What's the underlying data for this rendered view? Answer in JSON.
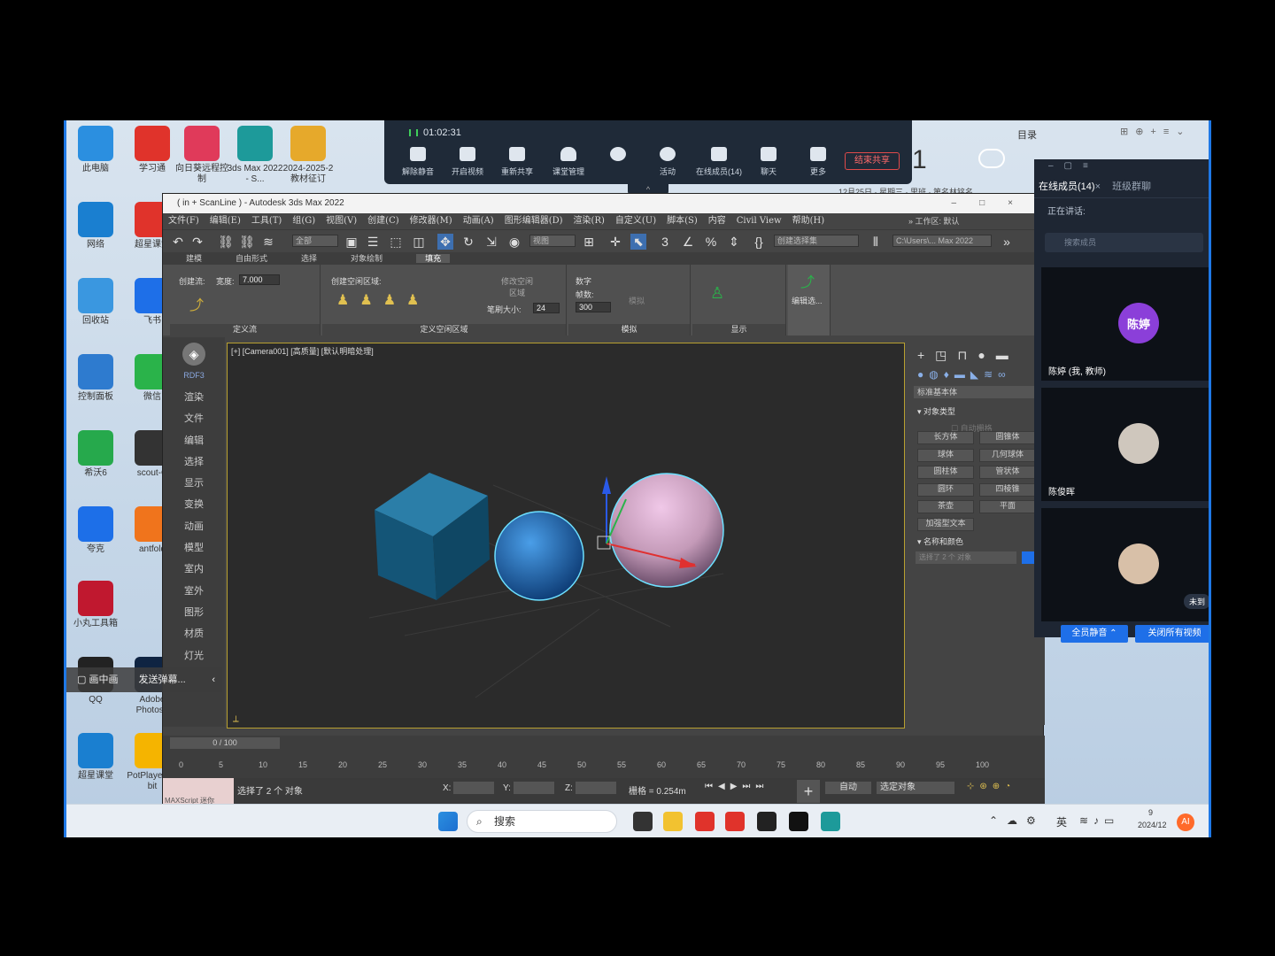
{
  "desktop_icons": [
    {
      "label": "此电脑",
      "color": "#2b8fe0"
    },
    {
      "label": "学习通",
      "color": "#e0332b"
    },
    {
      "label": "向日葵远程控制",
      "color": "#e03a5a"
    },
    {
      "label": "3ds Max 2022 - S...",
      "color": "#1d9a9a"
    },
    {
      "label": "2024-2025-2 教材征订",
      "color": "#e6a92b"
    },
    {
      "label": "网络",
      "color": "#1a7fd0"
    },
    {
      "label": "超星课堂",
      "color": "#e0332b"
    },
    {
      "label": "回收站",
      "color": "#3a97e0"
    },
    {
      "label": "飞书",
      "color": "#1e6fe8"
    },
    {
      "label": "控制面板",
      "color": "#2e7bcf"
    },
    {
      "label": "微信",
      "color": "#2ab34a"
    },
    {
      "label": "希沃6",
      "color": "#26a94c"
    },
    {
      "label": "scout-C",
      "color": "#333333"
    },
    {
      "label": "夸克",
      "color": "#1d6fe8"
    },
    {
      "label": "antfold",
      "color": "#f0741c"
    },
    {
      "label": "小丸工具箱",
      "color": "#c0182f"
    },
    {
      "label": "QQ",
      "color": "#222222"
    },
    {
      "label": "Adobe Photosh",
      "color": "#0f2442"
    },
    {
      "label": "超星课堂",
      "color": "#1a7fd0"
    },
    {
      "label": "PotPlayer 64 bit",
      "color": "#f5b400"
    }
  ],
  "meeting_bar": {
    "timer": "01:02:31",
    "buttons": [
      "解除静音",
      "开启视频",
      "重新共享",
      "课堂管理",
      "",
      "活动",
      "在线成员(14)",
      "聊天",
      "更多"
    ],
    "end_share": "结束共享",
    "handle": "^"
  },
  "right_pane": {
    "big_number": "1",
    "catalog": "目录",
    "date_hint": "12月25日 · 星期三 · 里班 · 第名林铭名"
  },
  "max_window": {
    "title": "( in + ScanLine ) - Autodesk 3ds Max 2022",
    "menus": [
      "文件(F)",
      "编辑(E)",
      "工具(T)",
      "组(G)",
      "视图(V)",
      "创建(C)",
      "修改器(M)",
      "动画(A)",
      "图形编辑器(D)",
      "渲染(R)",
      "自定义(U)",
      "脚本(S)",
      "内容",
      "Civil View",
      "帮助(H)"
    ],
    "workspace_label": "工作区:",
    "workspace_value": "默认",
    "toolbar_all": "全部",
    "toolbar_view": "视图",
    "toolbar_selset": "创建选择集",
    "toolbar_path": "C:\\Users\\... Max 2022",
    "ribbon_tabs": [
      "建模",
      "自由形式",
      "选择",
      "对象绘制",
      "填充"
    ],
    "ribbon_active": "填充",
    "ribbon": {
      "flow_label": "创建流:",
      "width_label": "宽度:",
      "width_value": "7.000",
      "flow_caption": "定义流",
      "area_label": "创建空闲区域:",
      "modify_area": "修改空闲区域",
      "brush_label": "笔刷大小:",
      "brush_value": "24",
      "area_caption": "定义空闲区域",
      "number_label": "数字",
      "frames_label": "帧数:",
      "frames_value": "300",
      "simulate": "模拟",
      "sim_caption": "模拟",
      "display_caption": "显示",
      "edit_sel": "编辑选..."
    },
    "left_strip": [
      "RDF3",
      "渲染",
      "文件",
      "编辑",
      "选择",
      "显示",
      "变换",
      "动画",
      "模型",
      "室内",
      "室外",
      "图形",
      "材质",
      "灯光"
    ],
    "viewport_label": "[+] [Camera001] [高质量] [默认明暗处理]",
    "command_panel": {
      "category": "标准基本体",
      "object_type": "对象类型",
      "autogrid": "自动栅格",
      "objects": [
        "长方体",
        "圆锥体",
        "球体",
        "几何球体",
        "圆柱体",
        "管状体",
        "圆环",
        "四棱锥",
        "茶壶",
        "平面",
        "加强型文本"
      ],
      "name_color": "名称和颜色",
      "selected": "选择了 2 个 对象"
    },
    "timeline": {
      "frame": "0 / 100",
      "ticks": [
        "0",
        "5",
        "10",
        "15",
        "20",
        "25",
        "30",
        "35",
        "40",
        "45",
        "50",
        "55",
        "60",
        "65",
        "70",
        "75",
        "80",
        "85",
        "90",
        "95",
        "100"
      ]
    },
    "status": {
      "message": "选择了 2 个 对象",
      "x_label": "X:",
      "y_label": "Y:",
      "z_label": "Z:",
      "grid": "栅格 = 0.254m",
      "auto": "自动",
      "selected_object": "选定对象",
      "maxscript": "MAXScript 迷你"
    }
  },
  "chat": {
    "tab_members": "在线成员(14)",
    "tab_group": "班级群聊",
    "speaking": "正在讲话:",
    "search": "搜索成员",
    "members": [
      {
        "avatar_text": "陈婷",
        "name": "陈婷 (我, 教师)",
        "color": "#8b3fd9"
      },
      {
        "avatar_text": "",
        "name": "陈俊晖",
        "color": "#cfc7bd"
      },
      {
        "avatar_text": "",
        "name": "",
        "color": "#d8c0a8"
      }
    ],
    "unmuted_hint": "未到",
    "mute_all": "全员静音",
    "close_video": "关闭所有视频"
  },
  "popup": {
    "left": "画中画",
    "right": "发送弹幕..."
  },
  "taskbar": {
    "search": "搜索",
    "lang": "英",
    "date": "2024/12",
    "time": "9"
  }
}
